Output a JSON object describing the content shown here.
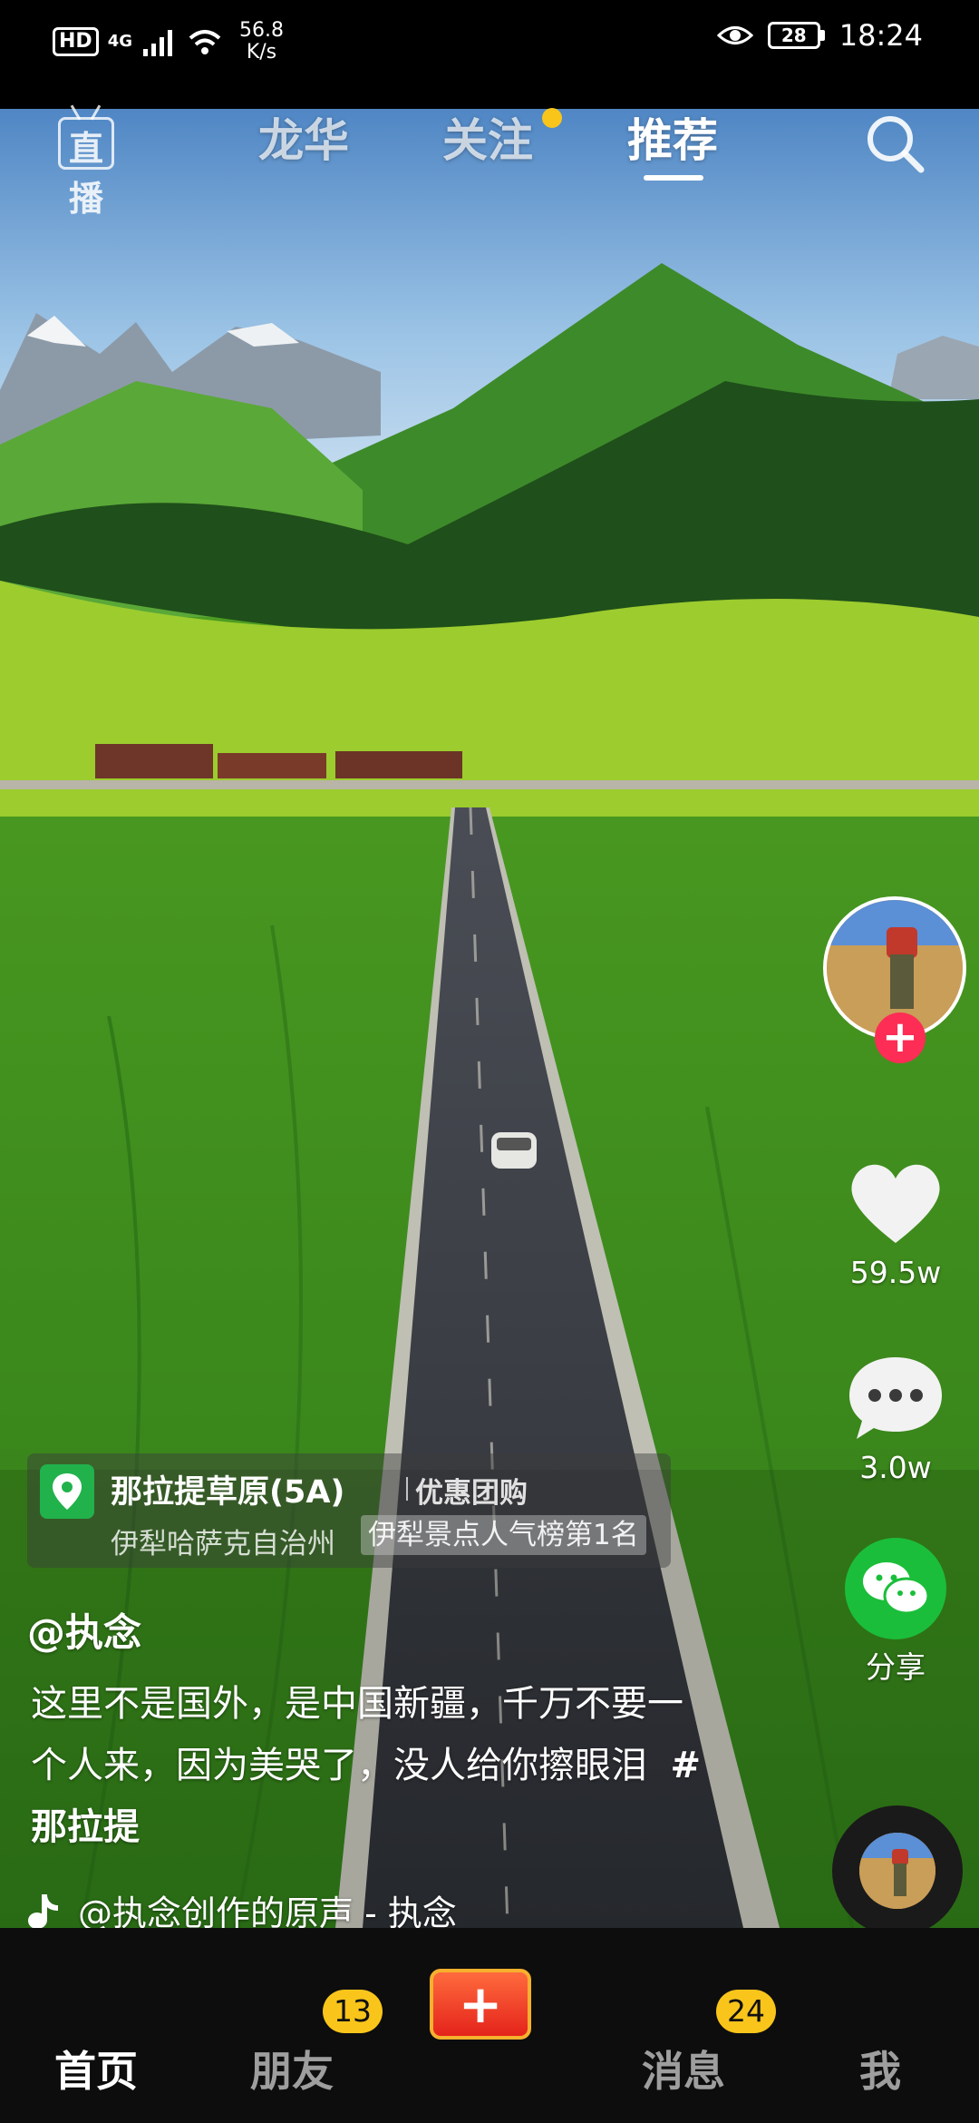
{
  "status_bar": {
    "hd": "HD",
    "network": "4G",
    "speed_value": "56.8",
    "speed_unit": "K/s",
    "battery": "28",
    "time": "18:24"
  },
  "top_nav": {
    "live_label": "直播",
    "tabs": [
      {
        "label": "龙华",
        "active": false
      },
      {
        "label": "关注",
        "active": false,
        "has_dot": true
      },
      {
        "label": "推荐",
        "active": true
      }
    ]
  },
  "side_actions": {
    "like_count": "59.5w",
    "comment_count": "3.0w",
    "share_label": "分享"
  },
  "location": {
    "name": "那拉提草原(5A)",
    "deal_label": "优惠团购",
    "region": "伊犁哈萨克自治州",
    "rank_tag": "伊犁景点人气榜第1名"
  },
  "post": {
    "author": "@执念",
    "caption": "这里不是国外，是中国新疆，千万不要一个人来，因为美哭了，没人给你擦眼泪",
    "hashtag": "#那拉提",
    "music": "@执念创作的原声 - 执念"
  },
  "bottom_nav": {
    "home": "首页",
    "friends": "朋友",
    "friends_badge": "13",
    "messages": "消息",
    "messages_badge": "24",
    "me": "我"
  },
  "colors": {
    "accent_follow": "#fd2d55",
    "badge": "#f9c51b",
    "share_green": "#1bbe3a",
    "location_green": "#22b24c"
  }
}
